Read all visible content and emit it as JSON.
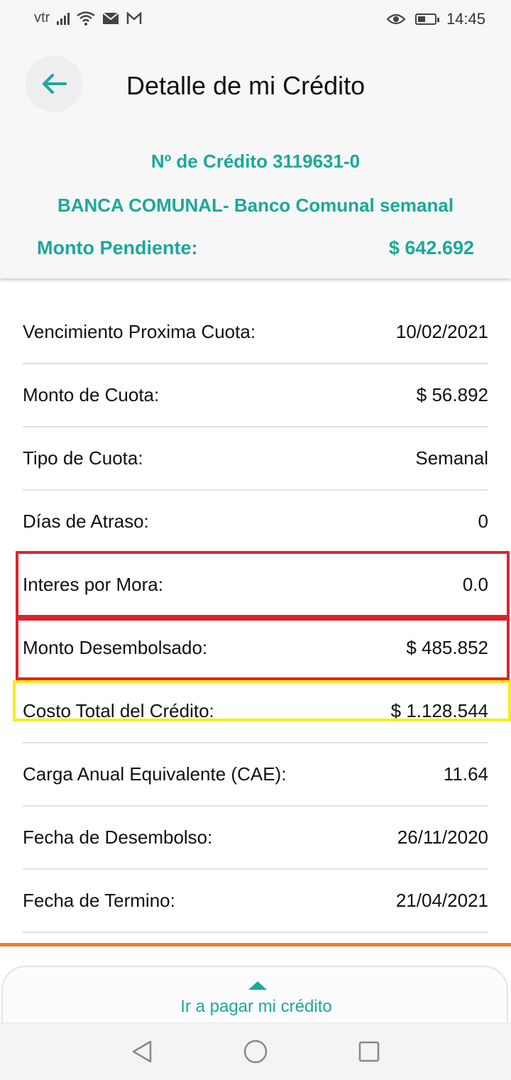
{
  "status_bar": {
    "carrier": "vtr",
    "time": "14:45",
    "battery_level": 0.45,
    "icons": [
      "signal-icon",
      "wifi-icon",
      "mail-icon",
      "gmail-icon",
      "eye-icon",
      "battery-icon"
    ]
  },
  "header": {
    "title": "Detalle de mi Crédito",
    "credit_number": "Nº de Crédito 3119631-0",
    "credit_type": "BANCA COMUNAL- Banco Comunal semanal",
    "pending_label": "Monto Pendiente:",
    "pending_value": "$ 642.692"
  },
  "details": [
    {
      "label": "Vencimiento Proxima Cuota:",
      "value": "10/02/2021"
    },
    {
      "label": "Monto de Cuota:",
      "value": "$ 56.892"
    },
    {
      "label": "Tipo de Cuota:",
      "value": "Semanal"
    },
    {
      "label": "Días de Atraso:",
      "value": "0"
    },
    {
      "label": "Interes por Mora:",
      "value": "0.0"
    },
    {
      "label": "Monto Desembolsado:",
      "value": "$ 485.852"
    },
    {
      "label": "Costo Total del Crédito:",
      "value": "$ 1.128.544"
    },
    {
      "label": "Carga Anual Equivalente (CAE):",
      "value": "11.64"
    },
    {
      "label": "Fecha de Desembolso:",
      "value": "26/11/2020"
    },
    {
      "label": "Fecha de Termino:",
      "value": "21/04/2021"
    }
  ],
  "pay_panel": {
    "label": "Ir a pagar mi crédito"
  },
  "colors": {
    "accent": "#1ba89b",
    "highlight_red": "#e0232a",
    "highlight_yellow": "#f7ec1c",
    "orange_bar": "#ef7d2c"
  }
}
